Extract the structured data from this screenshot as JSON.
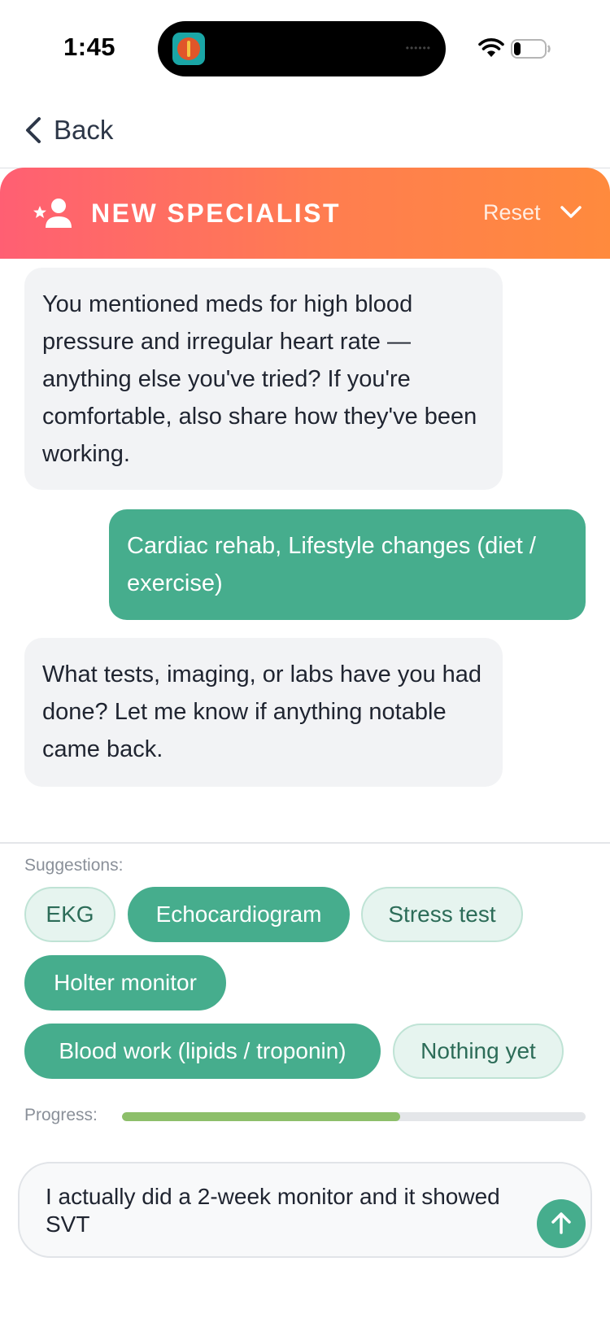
{
  "status_bar": {
    "time": "1:45",
    "island_dots": "••••••"
  },
  "nav": {
    "back_label": "Back"
  },
  "banner": {
    "title": "NEW SPECIALIST",
    "reset_label": "Reset"
  },
  "messages": [
    {
      "role": "assistant",
      "text": "You mentioned meds for high blood pressure and irregular heart rate — anything else you've tried? If you're comfortable, also share how they've been working."
    },
    {
      "role": "user",
      "text": "Cardiac rehab, Lifestyle changes (diet / exercise)"
    },
    {
      "role": "assistant",
      "text": "What tests, imaging, or labs have you had done? Let me know if anything notable came back."
    }
  ],
  "suggestions": {
    "label": "Suggestions:",
    "chips": [
      {
        "label": "EKG",
        "selected": false
      },
      {
        "label": "Echocardiogram",
        "selected": true
      },
      {
        "label": "Stress test",
        "selected": false
      },
      {
        "label": "Holter monitor",
        "selected": true
      },
      {
        "label": "Blood work (lipids / troponin)",
        "selected": true
      },
      {
        "label": "Nothing yet",
        "selected": false
      }
    ]
  },
  "progress": {
    "label": "Progress:",
    "value_percent": 60
  },
  "composer": {
    "value": "I actually did a 2-week monitor and it showed SVT"
  },
  "colors": {
    "accent_green": "#46ad8d",
    "banner_start": "#ff5f73",
    "banner_end": "#ff8a3d",
    "progress_fill": "#8dbf6a"
  },
  "icons": [
    "wifi-icon",
    "battery-icon",
    "chevron-left-icon",
    "specialist-icon",
    "chevron-down-icon",
    "arrow-up-icon"
  ]
}
